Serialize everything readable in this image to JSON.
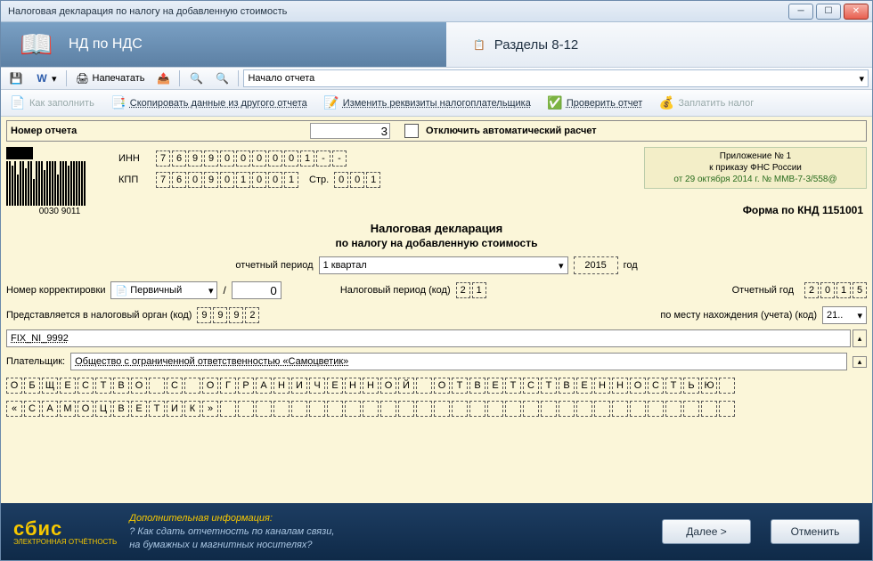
{
  "window": {
    "title": "Налоговая декларация по налогу на добавленную стоимость"
  },
  "header": {
    "tab1": "НД по НДС",
    "tab2": "Разделы 8-12"
  },
  "toolbar1": {
    "print": "Напечатать",
    "combo": "Начало отчета"
  },
  "toolbar2": {
    "howto": "Как заполнить",
    "copy": "Скопировать данные из другого отчета",
    "edit": "Изменить реквизиты налогоплательщика",
    "check": "Проверить отчет",
    "pay": "Заплатить налог"
  },
  "top": {
    "label": "Номер отчета",
    "value": "3",
    "label2": "Отключить автоматический расчет"
  },
  "codes": {
    "inn_label": "ИНН",
    "inn": [
      "7",
      "6",
      "9",
      "9",
      "0",
      "0",
      "0",
      "0",
      "0",
      "1",
      "-",
      "-"
    ],
    "kpp_label": "КПП",
    "kpp": [
      "7",
      "6",
      "0",
      "9",
      "0",
      "1",
      "0",
      "0",
      "1"
    ],
    "page_label": "Стр.",
    "page": [
      "0",
      "0",
      "1"
    ],
    "barcode_caption": "0030 9011"
  },
  "appinfo": {
    "l1": "Приложение № 1",
    "l2": "к приказу ФНС России",
    "l3": "от 29 октября 2014 г. № ММВ-7-3/558@"
  },
  "form": {
    "title": "Налоговая декларация",
    "subtitle": "по налогу на добавленную стоимость",
    "knd": "Форма по КНД 1151001",
    "period_label": "отчетный период",
    "period_value": "1 квартал",
    "year": "2015",
    "year_suffix": "год",
    "corr_label": "Номер корректировки",
    "corr_type": "Первичный",
    "corr_num": "0",
    "tax_period_label": "Налоговый период (код)",
    "tax_period": [
      "2",
      "1"
    ],
    "report_year_label": "Отчетный год",
    "report_year": [
      "2",
      "0",
      "1",
      "5"
    ],
    "organ_label": "Представляется в налоговый орган (код)",
    "organ": [
      "9",
      "9",
      "9",
      "2"
    ],
    "place_label": "по месту нахождения (учета) (код)",
    "place_value": "21..",
    "fix_value": "FIX_NI_9992",
    "payer_label": "Плательщик:",
    "payer_value": "Общество с ограниченной ответственностью «Самоцветик»",
    "line1": [
      "О",
      "Б",
      "Щ",
      "Е",
      "С",
      "Т",
      "В",
      "О",
      "",
      "С",
      "",
      "О",
      "Г",
      "Р",
      "А",
      "Н",
      "И",
      "Ч",
      "Е",
      "Н",
      "Н",
      "О",
      "Й",
      "",
      "О",
      "Т",
      "В",
      "Е",
      "Т",
      "С",
      "Т",
      "В",
      "Е",
      "Н",
      "Н",
      "О",
      "С",
      "Т",
      "Ь",
      "Ю",
      ""
    ],
    "line2": [
      "«",
      "С",
      "А",
      "М",
      "О",
      "Ц",
      "В",
      "Е",
      "Т",
      "И",
      "К",
      "»",
      "",
      "",
      "",
      "",
      "",
      "",
      "",
      "",
      "",
      "",
      "",
      "",
      "",
      "",
      "",
      "",
      "",
      "",
      "",
      "",
      "",
      "",
      "",
      "",
      "",
      "",
      "",
      "",
      ""
    ]
  },
  "footer": {
    "logo": "сбис",
    "logo_sub": "ЭЛЕКТРОННАЯ ОТЧЁТНОСТЬ",
    "info_title": "Дополнительная информация:",
    "info_q": "? Как сдать отчетность по каналам связи,\nна бумажных и магнитных носителях?",
    "next": "Далее >",
    "cancel": "Отменить"
  }
}
